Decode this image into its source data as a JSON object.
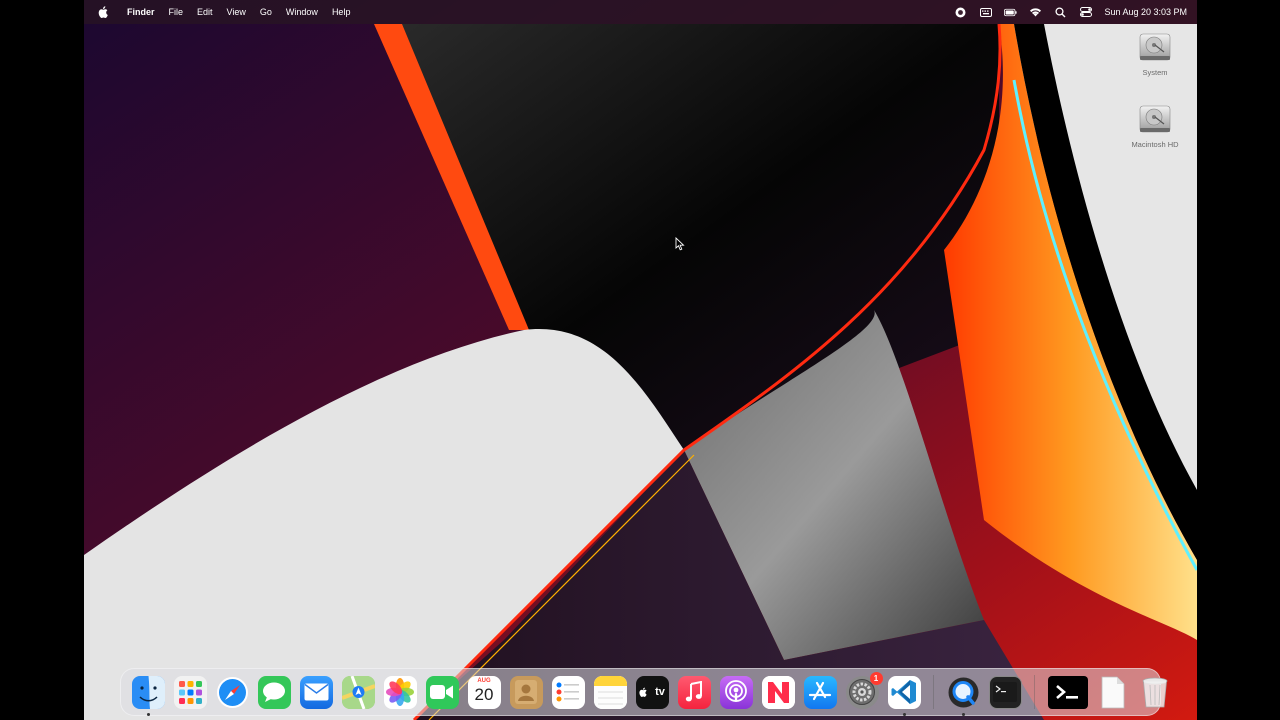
{
  "menubar": {
    "app_name": "Finder",
    "menus": [
      "File",
      "Edit",
      "View",
      "Go",
      "Window",
      "Help"
    ],
    "status_icons": [
      "screen-record-icon",
      "keyboard-icon",
      "battery-icon",
      "wifi-icon",
      "search-icon",
      "control-center-icon"
    ],
    "clock": "Sun Aug 20  3:03 PM"
  },
  "desktop": {
    "icons": [
      {
        "label": "System"
      },
      {
        "label": "Macintosh HD"
      }
    ]
  },
  "dock": {
    "apps": [
      {
        "name": "Finder",
        "running": true
      },
      {
        "name": "Launchpad"
      },
      {
        "name": "Safari"
      },
      {
        "name": "Messages"
      },
      {
        "name": "Mail"
      },
      {
        "name": "Maps"
      },
      {
        "name": "Photos"
      },
      {
        "name": "FaceTime"
      },
      {
        "name": "Calendar",
        "month": "AUG",
        "day": "20"
      },
      {
        "name": "Contacts"
      },
      {
        "name": "Reminders"
      },
      {
        "name": "Notes"
      },
      {
        "name": "Apple TV",
        "label": "tv"
      },
      {
        "name": "Music"
      },
      {
        "name": "Podcasts"
      },
      {
        "name": "News"
      },
      {
        "name": "App Store"
      },
      {
        "name": "System Settings",
        "badge": "1"
      },
      {
        "name": "Visual Studio Code",
        "running": true
      },
      {
        "name": "QuickTime Player",
        "running": true
      },
      {
        "name": "Terminal"
      },
      {
        "name": "Terminal (recent)"
      },
      {
        "name": "Document"
      },
      {
        "name": "Trash"
      }
    ]
  },
  "colors": {
    "menubar_bg": "#281423",
    "accent_red": "#ff3b30"
  }
}
